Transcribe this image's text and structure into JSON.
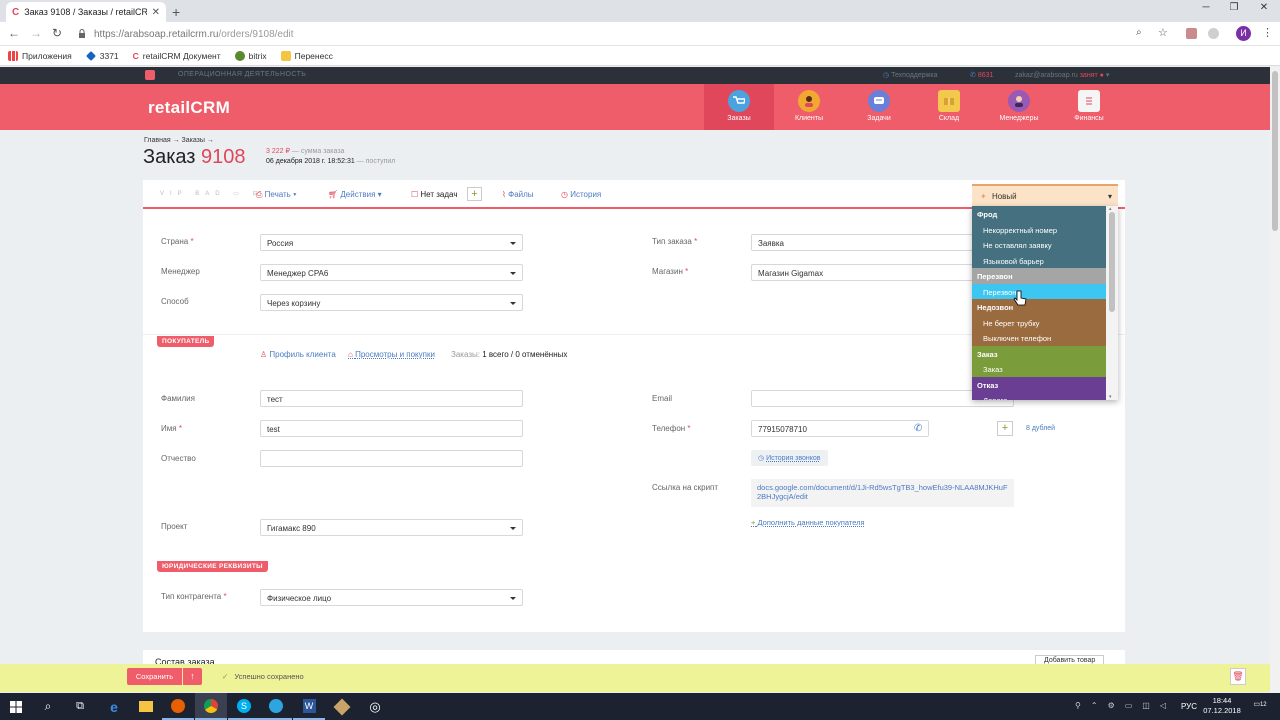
{
  "browser": {
    "tab_title": "Заказ 9108 / Заказы / retailCRM",
    "url_host": "https://arabsoap.retailcrm.ru",
    "url_path": "/orders/9108/edit",
    "avatar_letter": "И",
    "bookmarks": [
      "Приложения",
      "3371",
      "retailCRM Документ",
      "bitrix",
      "Перенесс"
    ]
  },
  "crm": {
    "top_bar": {
      "section": "ОПЕРАЦИОННАЯ ДЕЯТЕЛЬНОСТЬ",
      "support": "Техподдержка",
      "calls": "8631",
      "email": "zakaz@arabsoap.ru",
      "status": "занят"
    },
    "logo": "retailCRM",
    "nav": [
      {
        "label": "Заказы",
        "color": "#4aa3df"
      },
      {
        "label": "Клиенты",
        "color": "#f0a830"
      },
      {
        "label": "Задачи",
        "color": "#6a7fd8"
      },
      {
        "label": "Склад",
        "color": "#f2c94c"
      },
      {
        "label": "Менеджеры",
        "color": "#9b59b6"
      },
      {
        "label": "Финансы",
        "color": "#e8e8e8"
      }
    ],
    "breadcrumb": "Главная → Заказы →",
    "order_title": "Заказ",
    "order_number": "9108",
    "order_sum": "3 222 ₽",
    "order_sum_note": "— сумма заказа",
    "order_date": "06 декабря 2018 г. 18:52:31",
    "order_date_note": "— поступил",
    "toolbar": {
      "print": "Печать",
      "actions": "Действия",
      "tasks": "Нет задач",
      "files": "Файлы",
      "history": "История",
      "status": "Новый"
    },
    "form": {
      "country_label": "Страна",
      "country": "Россия",
      "manager_label": "Менеджер",
      "manager": "Менеджер CPA6",
      "method_label": "Способ",
      "method": "Через корзину",
      "order_type_label": "Тип заказа",
      "order_type": "Заявка",
      "shop_label": "Магазин",
      "shop": "Магазин Gigamax"
    },
    "customer": {
      "section_tag": "ПОКУПАТЕЛЬ",
      "profile_link": "Профиль клиента",
      "views_link": "Просмотры и покупки",
      "orders_label": "Заказы:",
      "orders_value": "1 всего / 0 отменённых",
      "lastname_label": "Фамилия",
      "lastname": "тест",
      "firstname_label": "Имя",
      "firstname": "test",
      "patronymic_label": "Отчество",
      "patronymic": "",
      "email_label": "Email",
      "email": "",
      "phone_label": "Телефон",
      "phone": "77915078710",
      "duplicates": "8 дублей",
      "call_history": "История звонков",
      "script_label": "Ссылка на скрипт",
      "script_url": "docs.google.com/document/d/1Ji-Rd5wsTgTB3_howEfu39-NLAA8MJKHuF2BHJygcjA/edit",
      "add_customer_data": "Дополнить данные покупателя",
      "project_label": "Проект",
      "project": "Гигамакс 890"
    },
    "legal": {
      "section_tag": "ЮРИДИЧЕСКИЕ РЕКВИЗИТЫ",
      "contractor_label": "Тип контрагента",
      "contractor": "Физическое лицо"
    },
    "composition_title": "Состав заказа",
    "add_goods": "Добавить товар",
    "status_dropdown": [
      {
        "text": "Фрод",
        "kind": "group",
        "color": "#44707f"
      },
      {
        "text": "Некорректный номер",
        "kind": "item",
        "color": "#44707f"
      },
      {
        "text": "Не оставлял заявку",
        "kind": "item",
        "color": "#44707f"
      },
      {
        "text": "Языковой барьер",
        "kind": "item",
        "color": "#44707f"
      },
      {
        "text": "Перезвон",
        "kind": "group",
        "color": "#a5a5a5"
      },
      {
        "text": "Перезвон",
        "kind": "item",
        "color": "#3dc6f2"
      },
      {
        "text": "Недозвон",
        "kind": "group",
        "color": "#9a6b3f"
      },
      {
        "text": "Не берет трубку",
        "kind": "item",
        "color": "#9a6b3f"
      },
      {
        "text": "Выключен телефон",
        "kind": "item",
        "color": "#9a6b3f"
      },
      {
        "text": "Заказ",
        "kind": "group",
        "color": "#7b9c3a"
      },
      {
        "text": "Заказ",
        "kind": "item",
        "color": "#7b9c3a"
      },
      {
        "text": "Отказ",
        "kind": "group",
        "color": "#6a3f93"
      },
      {
        "text": "Дорого",
        "kind": "item",
        "color": "#6a3f93"
      }
    ],
    "save_bar": {
      "save": "Сохранить",
      "saved": "Успешно сохранено"
    }
  },
  "taskbar": {
    "lang": "РУС",
    "time": "18:44",
    "date": "07.12.2018",
    "notifications": "12"
  }
}
